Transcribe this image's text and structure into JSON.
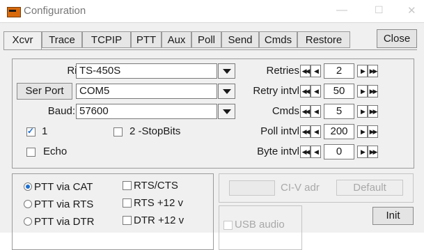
{
  "window": {
    "title": "Configuration",
    "controls": {
      "minimize": "—",
      "maximize": "☐",
      "close": "✕"
    }
  },
  "tabs": [
    {
      "label": "Xcvr"
    },
    {
      "label": "Trace"
    },
    {
      "label": "TCPIP"
    },
    {
      "label": "PTT"
    },
    {
      "label": "Aux"
    },
    {
      "label": "Poll"
    },
    {
      "label": "Send"
    },
    {
      "label": "Cmds"
    },
    {
      "label": "Restore"
    }
  ],
  "close_label": "Close",
  "rig": {
    "label": "Rig:",
    "value": "TS-450S"
  },
  "port": {
    "button_label": "Ser Port",
    "value": "COM5"
  },
  "baud": {
    "label": "Baud:",
    "value": "57600"
  },
  "stopbits": {
    "opt1_label": "1",
    "opt1_checked": true,
    "opt2_label": "2 -StopBits",
    "opt2_checked": false
  },
  "echo": {
    "label": "Echo",
    "checked": false
  },
  "params": [
    {
      "label": "Retries",
      "value": "2"
    },
    {
      "label": "Retry intvl",
      "value": "50"
    },
    {
      "label": "Cmds",
      "value": "5"
    },
    {
      "label": "Poll intvl",
      "value": "200"
    },
    {
      "label": "Byte intvl",
      "value": "0"
    }
  ],
  "spin_glyphs": {
    "fast_left": "◀◀",
    "left": "◀",
    "right": "▶",
    "fast_right": "▶▶"
  },
  "ptt": {
    "options": [
      {
        "label": "PTT via CAT",
        "selected": true
      },
      {
        "label": "PTT via RTS",
        "selected": false
      },
      {
        "label": "PTT via DTR",
        "selected": false
      }
    ],
    "checks": [
      {
        "label": "RTS/CTS",
        "checked": false
      },
      {
        "label": "RTS +12 v",
        "checked": false
      },
      {
        "label": "DTR +12 v",
        "checked": false
      }
    ]
  },
  "civ": {
    "label": "CI-V adr",
    "value": "",
    "default_label": "Default"
  },
  "usb_audio": {
    "label": "USB audio",
    "checked": false
  },
  "init_label": "Init"
}
